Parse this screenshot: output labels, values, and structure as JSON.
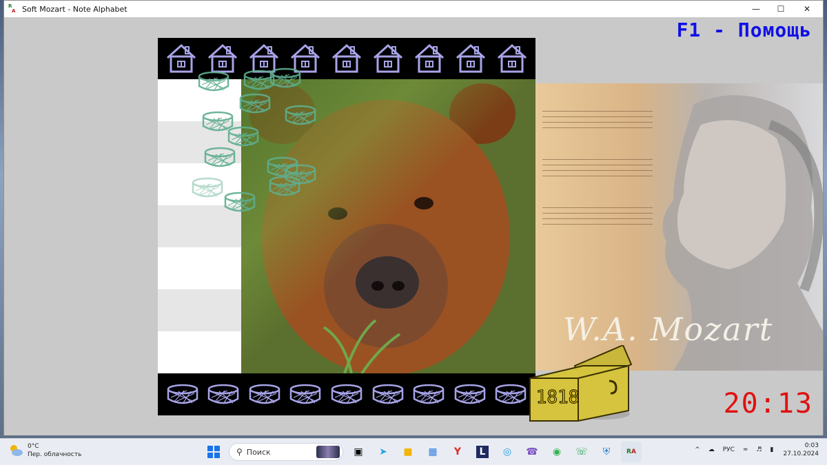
{
  "window": {
    "title": "Soft Mozart - Note Alphabet",
    "icon": "soft-mozart-app-icon"
  },
  "game": {
    "help_text": "F1 - Помощь",
    "score": "1818",
    "timer": "20:13",
    "mozart_signature": "W.A. Mozart"
  },
  "colors": {
    "help": "#1010e6",
    "timer": "#e01010",
    "score": "#ffd400",
    "house": "#a7a4e8",
    "basket_floating": "#5fae8f",
    "basket_slot": "#a7a4e8"
  },
  "taskbar": {
    "weather_temp": "0°C",
    "weather_desc": "Пер. облачность",
    "search_placeholder": "Поиск",
    "language": "РУС",
    "time": "0:03",
    "date": "27.10.2024"
  }
}
